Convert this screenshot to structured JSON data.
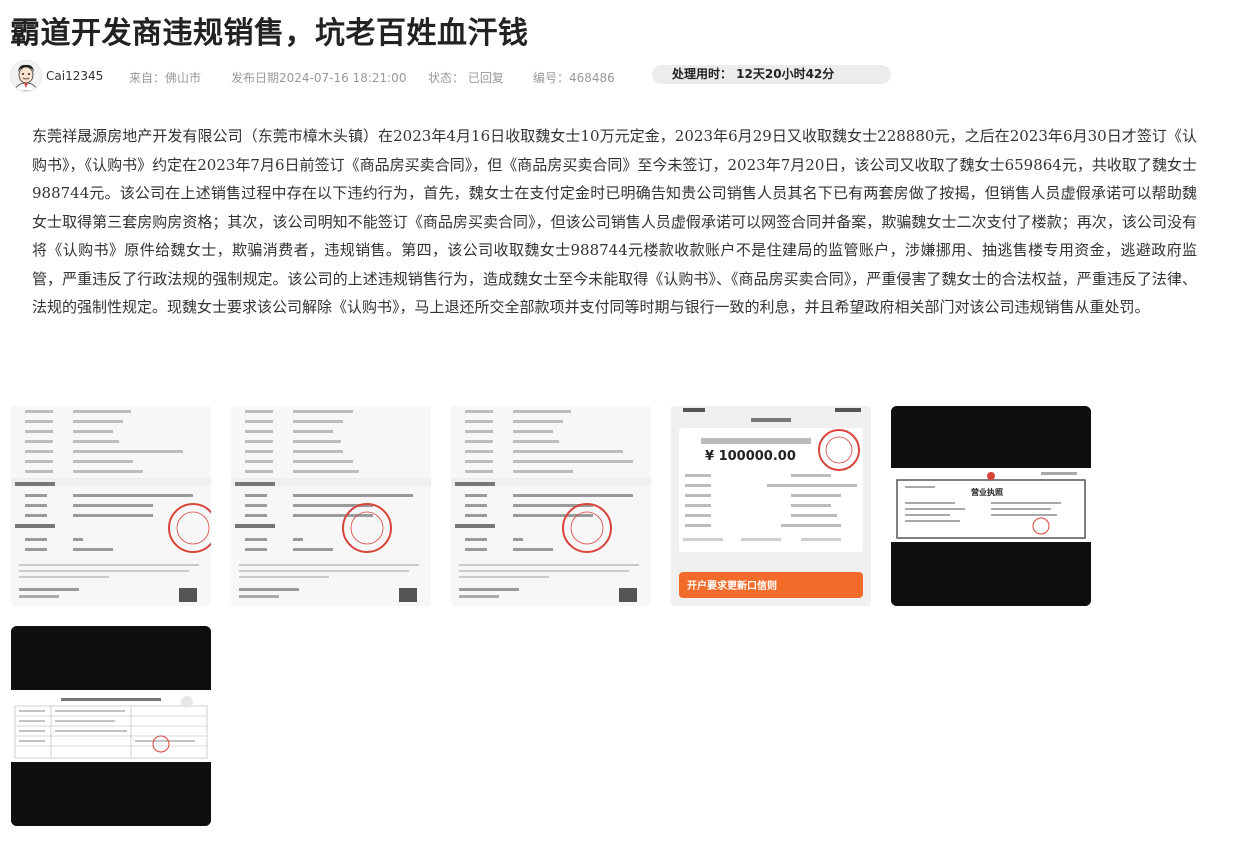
{
  "article": {
    "title": "霸道开发商违规销售，坑老百姓血汗钱",
    "author": "Cai12345",
    "source": "来自：佛山市",
    "published": "发布日期2024-07-16 18:21:00",
    "status": "状态：  已回复",
    "number": "编号：468486",
    "processing_time": "处理用时：  12天20小时42分",
    "body": "东莞祥晟源房地产开发有限公司（东莞市樟木头镇）在2023年4月16日收取魏女士10万元定金，2023年6月29日又收取魏女士228880元，之后在2023年6月30日才签订《认购书》，《认购书》约定在2023年7月6日前签订《商品房买卖合同》，但《商品房买卖合同》至今未签订，2023年7月20日，该公司又收取了魏女士659864元，共收取了魏女士988744元。该公司在上述销售过程中存在以下违约行为，首先，魏女士在支付定金时已明确告知贵公司销售人员其名下已有两套房做了按揭，但销售人员虚假承诺可以帮助魏女士取得第三套房购房资格；其次，该公司明知不能签订《商品房买卖合同》，但该公司销售人员虚假承诺可以网签合同并备案，欺骗魏女士二次支付了楼款；再次，该公司没有将《认购书》原件给魏女士，欺骗消费者，违规销售。第四，该公司收取魏女士988744元楼款收款账户不是住建局的监管账户，涉嫌挪用、抽逃售楼专用资金，逃避政府监管，严重违反了行政法规的强制规定。该公司的上述违规销售行为，造成魏女士至今未能取得《认购书》、《商品房买卖合同》，严重侵害了魏女士的合法权益，严重违反了法律、法规的强制性规定。现魏女士要求该公司解除《认购书》，马上退还所交全部款项并支付同等时期与银行一致的利息，并且希望政府相关部门对该公司违规销售从重处罚。"
  },
  "attachments": {
    "receipt_amount": "¥ 100000.00",
    "license_title": "营业执照",
    "banner_text": "开户要求更新口信则"
  },
  "colors": {
    "title": "#222222",
    "meta": "#999999",
    "pill_bg": "#ececec",
    "stamp_red": "#d9443a",
    "banner_orange": "#f26b2a"
  }
}
